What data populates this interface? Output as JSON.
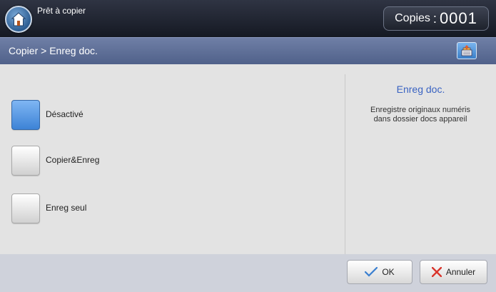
{
  "status_bar": {
    "status_text": "Prêt à copier",
    "copies_label": "Copies",
    "copies_colon": ":",
    "copies_count": "0001",
    "home_icon": "home-icon"
  },
  "breadcrumb": {
    "text": "Copier > Enreg doc.",
    "job_status_icon": "job-status-icon"
  },
  "options": [
    {
      "label": "Désactivé",
      "selected": true
    },
    {
      "label": "Copier&Enreg",
      "selected": false
    },
    {
      "label": "Enreg seul",
      "selected": false
    }
  ],
  "description": {
    "title": "Enreg doc.",
    "line1": "Enregistre originaux numéris",
    "line2": "dans dossier docs appareil"
  },
  "actions": {
    "ok_label": "OK",
    "cancel_label": "Annuler"
  },
  "colors": {
    "accent_blue": "#3d83d6",
    "title_blue": "#3a63c2",
    "cancel_red": "#d9342b",
    "ok_blue": "#3a7fd0"
  }
}
